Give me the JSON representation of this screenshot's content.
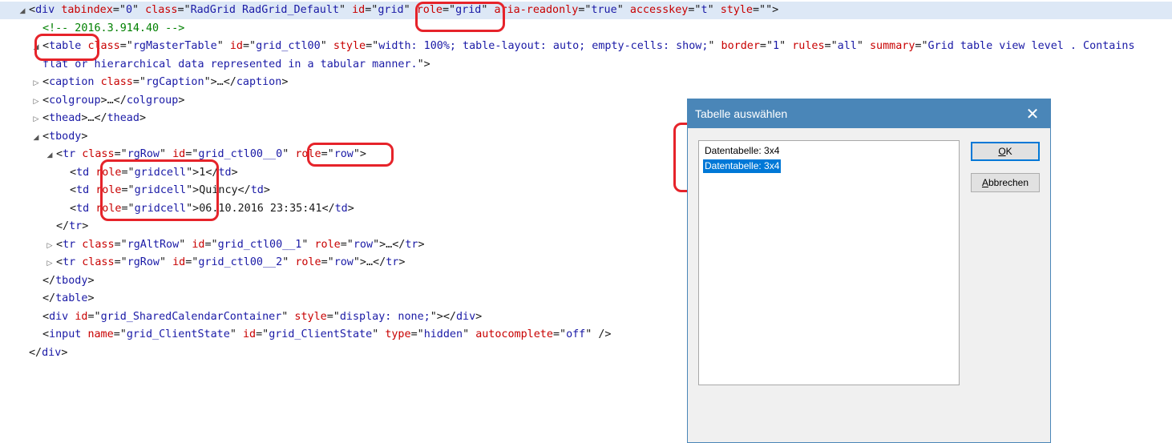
{
  "tree": {
    "lines": [
      {
        "tri": "down",
        "indent": 0,
        "parts": [
          [
            "punc",
            "<"
          ],
          [
            "tag",
            "div"
          ],
          [
            "txt",
            " "
          ],
          [
            "attr",
            "tabindex"
          ],
          [
            "punc",
            "=\""
          ],
          [
            "val",
            "0"
          ],
          [
            "punc",
            "\" "
          ],
          [
            "attr",
            "class"
          ],
          [
            "punc",
            "=\""
          ],
          [
            "val",
            "RadGrid RadGrid_Default"
          ],
          [
            "punc",
            "\" "
          ],
          [
            "attr",
            "id"
          ],
          [
            "punc",
            "=\""
          ],
          [
            "val",
            "grid"
          ],
          [
            "punc",
            "\" "
          ],
          [
            "attr",
            "role"
          ],
          [
            "punc",
            "=\""
          ],
          [
            "val",
            "grid"
          ],
          [
            "punc",
            "\" "
          ],
          [
            "attr",
            "aria-readonly"
          ],
          [
            "punc",
            "=\""
          ],
          [
            "val",
            "true"
          ],
          [
            "punc",
            "\" "
          ],
          [
            "attr",
            "accesskey"
          ],
          [
            "punc",
            "=\""
          ],
          [
            "val",
            "t"
          ],
          [
            "punc",
            "\" "
          ],
          [
            "attr",
            "style"
          ],
          [
            "punc",
            "=\"\">"
          ]
        ],
        "selected": true
      },
      {
        "tri": "",
        "indent": 1,
        "parts": [
          [
            "cmt",
            "<!-- 2016.3.914.40 -->"
          ]
        ]
      },
      {
        "tri": "down",
        "indent": 1,
        "parts": [
          [
            "punc",
            "<"
          ],
          [
            "tag",
            "table"
          ],
          [
            "txt",
            " "
          ],
          [
            "attr",
            "class"
          ],
          [
            "punc",
            "=\""
          ],
          [
            "val",
            "rgMasterTable"
          ],
          [
            "punc",
            "\" "
          ],
          [
            "attr",
            "id"
          ],
          [
            "punc",
            "=\""
          ],
          [
            "val",
            "grid_ctl00"
          ],
          [
            "punc",
            "\" "
          ],
          [
            "attr",
            "style"
          ],
          [
            "punc",
            "=\""
          ],
          [
            "val",
            "width: 100%; table-layout: auto; empty-cells: show;"
          ],
          [
            "punc",
            "\" "
          ],
          [
            "attr",
            "border"
          ],
          [
            "punc",
            "=\""
          ],
          [
            "val",
            "1"
          ],
          [
            "punc",
            "\" "
          ],
          [
            "attr",
            "rules"
          ],
          [
            "punc",
            "=\""
          ],
          [
            "val",
            "all"
          ],
          [
            "punc",
            "\" "
          ],
          [
            "attr",
            "summary"
          ],
          [
            "punc",
            "=\""
          ],
          [
            "val",
            "Grid table view level . Contains"
          ]
        ]
      },
      {
        "tri": "",
        "indent": 1,
        "parts": [
          [
            "val",
            "flat or hierarchical data represented in a tabular manner."
          ],
          [
            "punc",
            "\">"
          ]
        ]
      },
      {
        "tri": "right",
        "indent": 1,
        "parts": [
          [
            "punc",
            "<"
          ],
          [
            "tag",
            "caption"
          ],
          [
            "txt",
            " "
          ],
          [
            "attr",
            "class"
          ],
          [
            "punc",
            "=\""
          ],
          [
            "val",
            "rgCaption"
          ],
          [
            "punc",
            "\">…</"
          ],
          [
            "tag",
            "caption"
          ],
          [
            "punc",
            ">"
          ]
        ]
      },
      {
        "tri": "right",
        "indent": 1,
        "parts": [
          [
            "punc",
            "<"
          ],
          [
            "tag",
            "colgroup"
          ],
          [
            "punc",
            ">…</"
          ],
          [
            "tag",
            "colgroup"
          ],
          [
            "punc",
            ">"
          ]
        ]
      },
      {
        "tri": "right",
        "indent": 1,
        "parts": [
          [
            "punc",
            "<"
          ],
          [
            "tag",
            "thead"
          ],
          [
            "punc",
            ">…</"
          ],
          [
            "tag",
            "thead"
          ],
          [
            "punc",
            ">"
          ]
        ]
      },
      {
        "tri": "down",
        "indent": 1,
        "parts": [
          [
            "punc",
            "<"
          ],
          [
            "tag",
            "tbody"
          ],
          [
            "punc",
            ">"
          ]
        ]
      },
      {
        "tri": "down",
        "indent": 2,
        "parts": [
          [
            "punc",
            "<"
          ],
          [
            "tag",
            "tr"
          ],
          [
            "txt",
            " "
          ],
          [
            "attr",
            "class"
          ],
          [
            "punc",
            "=\""
          ],
          [
            "val",
            "rgRow"
          ],
          [
            "punc",
            "\" "
          ],
          [
            "attr",
            "id"
          ],
          [
            "punc",
            "=\""
          ],
          [
            "val",
            "grid_ctl00__0"
          ],
          [
            "punc",
            "\" "
          ],
          [
            "attr",
            "role"
          ],
          [
            "punc",
            "=\""
          ],
          [
            "val",
            "row"
          ],
          [
            "punc",
            "\">"
          ]
        ]
      },
      {
        "tri": "",
        "indent": 3,
        "parts": [
          [
            "punc",
            "<"
          ],
          [
            "tag",
            "td"
          ],
          [
            "txt",
            " "
          ],
          [
            "attr",
            "role"
          ],
          [
            "punc",
            "=\""
          ],
          [
            "val",
            "gridcell"
          ],
          [
            "punc",
            "\">"
          ],
          [
            "txt",
            "1"
          ],
          [
            "punc",
            "</"
          ],
          [
            "tag",
            "td"
          ],
          [
            "punc",
            ">"
          ]
        ]
      },
      {
        "tri": "",
        "indent": 3,
        "parts": [
          [
            "punc",
            "<"
          ],
          [
            "tag",
            "td"
          ],
          [
            "txt",
            " "
          ],
          [
            "attr",
            "role"
          ],
          [
            "punc",
            "=\""
          ],
          [
            "val",
            "gridcell"
          ],
          [
            "punc",
            "\">"
          ],
          [
            "txt",
            "Quincy"
          ],
          [
            "punc",
            "</"
          ],
          [
            "tag",
            "td"
          ],
          [
            "punc",
            ">"
          ]
        ]
      },
      {
        "tri": "",
        "indent": 3,
        "parts": [
          [
            "punc",
            "<"
          ],
          [
            "tag",
            "td"
          ],
          [
            "txt",
            " "
          ],
          [
            "attr",
            "role"
          ],
          [
            "punc",
            "=\""
          ],
          [
            "val",
            "gridcell"
          ],
          [
            "punc",
            "\">"
          ],
          [
            "txt",
            "06.10.2016 23:35:41"
          ],
          [
            "punc",
            "</"
          ],
          [
            "tag",
            "td"
          ],
          [
            "punc",
            ">"
          ]
        ]
      },
      {
        "tri": "",
        "indent": 2,
        "parts": [
          [
            "punc",
            "</"
          ],
          [
            "tag",
            "tr"
          ],
          [
            "punc",
            ">"
          ]
        ]
      },
      {
        "tri": "right",
        "indent": 2,
        "parts": [
          [
            "punc",
            "<"
          ],
          [
            "tag",
            "tr"
          ],
          [
            "txt",
            " "
          ],
          [
            "attr",
            "class"
          ],
          [
            "punc",
            "=\""
          ],
          [
            "val",
            "rgAltRow"
          ],
          [
            "punc",
            "\" "
          ],
          [
            "attr",
            "id"
          ],
          [
            "punc",
            "=\""
          ],
          [
            "val",
            "grid_ctl00__1"
          ],
          [
            "punc",
            "\" "
          ],
          [
            "attr",
            "role"
          ],
          [
            "punc",
            "=\""
          ],
          [
            "val",
            "row"
          ],
          [
            "punc",
            "\">…</"
          ],
          [
            "tag",
            "tr"
          ],
          [
            "punc",
            ">"
          ]
        ]
      },
      {
        "tri": "right",
        "indent": 2,
        "parts": [
          [
            "punc",
            "<"
          ],
          [
            "tag",
            "tr"
          ],
          [
            "txt",
            " "
          ],
          [
            "attr",
            "class"
          ],
          [
            "punc",
            "=\""
          ],
          [
            "val",
            "rgRow"
          ],
          [
            "punc",
            "\" "
          ],
          [
            "attr",
            "id"
          ],
          [
            "punc",
            "=\""
          ],
          [
            "val",
            "grid_ctl00__2"
          ],
          [
            "punc",
            "\" "
          ],
          [
            "attr",
            "role"
          ],
          [
            "punc",
            "=\""
          ],
          [
            "val",
            "row"
          ],
          [
            "punc",
            "\">…</"
          ],
          [
            "tag",
            "tr"
          ],
          [
            "punc",
            ">"
          ]
        ]
      },
      {
        "tri": "",
        "indent": 1,
        "parts": [
          [
            "punc",
            "</"
          ],
          [
            "tag",
            "tbody"
          ],
          [
            "punc",
            ">"
          ]
        ]
      },
      {
        "tri": "",
        "indent": 1,
        "parts": [
          [
            "punc",
            "</"
          ],
          [
            "tag",
            "table"
          ],
          [
            "punc",
            ">"
          ]
        ]
      },
      {
        "tri": "",
        "indent": 1,
        "parts": [
          [
            "punc",
            "<"
          ],
          [
            "tag",
            "div"
          ],
          [
            "txt",
            " "
          ],
          [
            "attr",
            "id"
          ],
          [
            "punc",
            "=\""
          ],
          [
            "val",
            "grid_SharedCalendarContainer"
          ],
          [
            "punc",
            "\" "
          ],
          [
            "attr",
            "style"
          ],
          [
            "punc",
            "=\""
          ],
          [
            "val",
            "display: none;"
          ],
          [
            "punc",
            "\"></"
          ],
          [
            "tag",
            "div"
          ],
          [
            "punc",
            ">"
          ]
        ]
      },
      {
        "tri": "",
        "indent": 1,
        "parts": [
          [
            "punc",
            "<"
          ],
          [
            "tag",
            "input"
          ],
          [
            "txt",
            " "
          ],
          [
            "attr",
            "name"
          ],
          [
            "punc",
            "=\""
          ],
          [
            "val",
            "grid_ClientState"
          ],
          [
            "punc",
            "\" "
          ],
          [
            "attr",
            "id"
          ],
          [
            "punc",
            "=\""
          ],
          [
            "val",
            "grid_ClientState"
          ],
          [
            "punc",
            "\" "
          ],
          [
            "attr",
            "type"
          ],
          [
            "punc",
            "=\""
          ],
          [
            "val",
            "hidden"
          ],
          [
            "punc",
            "\" "
          ],
          [
            "attr",
            "autocomplete"
          ],
          [
            "punc",
            "=\""
          ],
          [
            "val",
            "off"
          ],
          [
            "punc",
            "\" />"
          ]
        ]
      },
      {
        "tri": "",
        "indent": 0,
        "parts": [
          [
            "punc",
            "</"
          ],
          [
            "tag",
            "div"
          ],
          [
            "punc",
            ">"
          ]
        ]
      }
    ]
  },
  "dialog": {
    "title": "Tabelle auswählen",
    "close_symbol": "✕",
    "list_items": [
      {
        "label": "Datentabelle: 3x4",
        "selected": false
      },
      {
        "label": "Datentabelle: 3x4",
        "selected": true
      }
    ],
    "ok_label_accel": "O",
    "ok_label_rest": "K",
    "cancel_label_accel": "A",
    "cancel_label_rest": "bbrechen"
  },
  "colors": {
    "highlight": "#e6232a",
    "dialog_title_bg": "#4a86b8",
    "list_selection": "#0078d7",
    "tag": "#1a1aa6",
    "attribute": "#c80000",
    "comment": "#008000"
  }
}
